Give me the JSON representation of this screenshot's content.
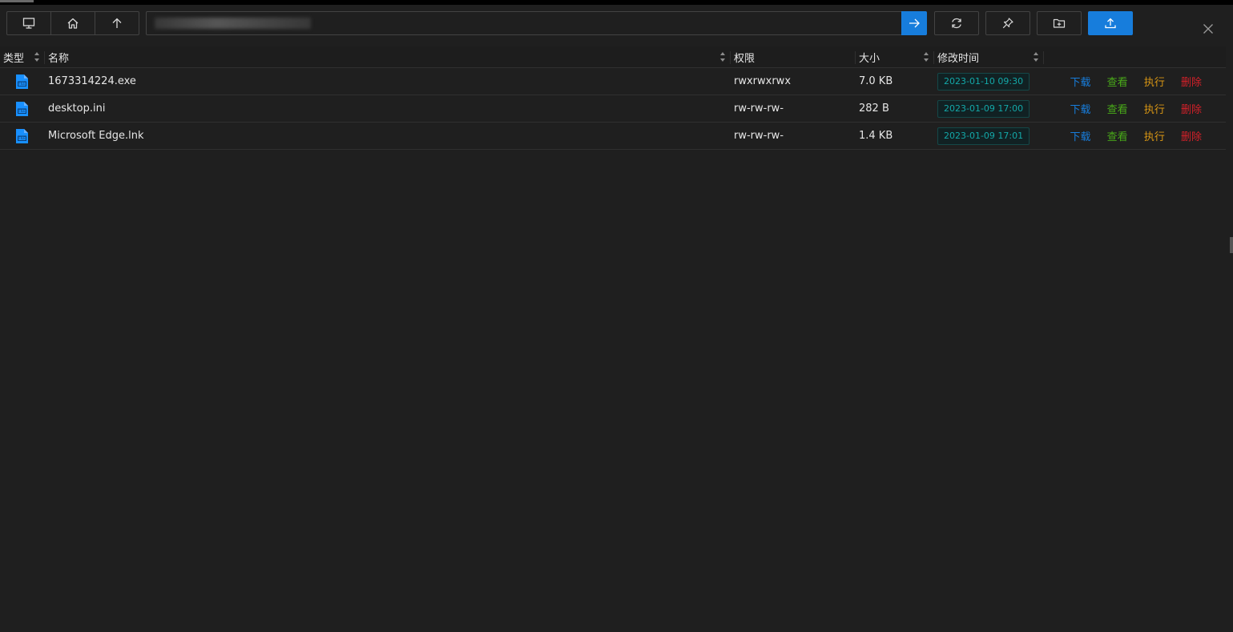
{
  "toolbar": {
    "path_value": "",
    "buttons": [
      "computer-icon",
      "home-icon",
      "arrow-up-icon",
      "refresh-icon",
      "pin-icon",
      "new-folder-icon",
      "upload-icon",
      "close-icon"
    ]
  },
  "table": {
    "columns": {
      "type": "类型",
      "name": "名称",
      "permission": "权限",
      "size": "大小",
      "modified": "修改时间"
    },
    "rows": [
      {
        "name": "1673314224.exe",
        "permission": "rwxrwxrwx",
        "size": "7.0 KB",
        "modified": "2023-01-10 09:30"
      },
      {
        "name": "desktop.ini",
        "permission": "rw-rw-rw-",
        "size": "282 B",
        "modified": "2023-01-09 17:00"
      },
      {
        "name": "Microsoft Edge.lnk",
        "permission": "rw-rw-rw-",
        "size": "1.4 KB",
        "modified": "2023-01-09 17:01"
      }
    ],
    "actions": {
      "download": "下载",
      "view": "查看",
      "execute": "执行",
      "delete": "删除"
    }
  },
  "colors": {
    "accent": "#177ddc",
    "view": "#49aa19",
    "execute": "#d89614",
    "delete": "#d32029",
    "tag": "#13a8a8"
  }
}
